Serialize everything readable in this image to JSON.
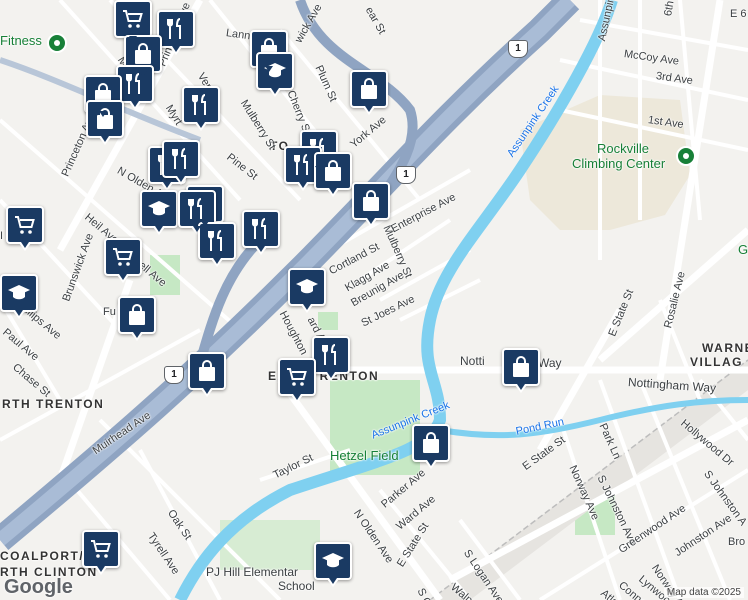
{
  "map": {
    "streets": {
      "mulberry_st_top": "Mulberry St",
      "mulberry_st_mid": "Mulberry St",
      "princeton_ave_top": "Princeton Ave",
      "princeton_ave_left": "Princeton Ave",
      "n_olden_ave_top": "N Olden Ave",
      "n_olden_ave_bottom": "N Olden Ave",
      "heil_ave": "Heil Ave",
      "brunswick_ave": "Brunswick Ave",
      "pine_st": "Pine St",
      "york_ave": "York Ave",
      "cherry_st": "Cherry St",
      "plum_st": "Plum St",
      "vernon": "Vern",
      "myrtle": "Myrt",
      "mulberry_partial": "Mul",
      "lanning": "Lannin",
      "wick_ave": "wick Ave",
      "bear_st": "ear St",
      "enterprise_ave": "Enterprise Ave",
      "cortland_st": "Cortland St",
      "klagg_ave": "Klagg Ave",
      "breunig_ave": "Breunig Ave",
      "st_joes_ave": "St Joes Ave",
      "houghton": "Houghton",
      "ward_av": "ard Av",
      "ell_ave": "ell Ave",
      "fu": "Fu",
      "phillips_ave": "hillips Ave",
      "paul_ave": "Paul Ave",
      "chase_st": "Chase St",
      "muirhead_ave": "Muirhead Ave",
      "oak_st": "Oak St",
      "tyrell_ave": "Tyrell Ave",
      "taylor_st": "Taylor St",
      "parker_ave": "Parker Ave",
      "ward_ave": "Ward Ave",
      "e_state_st_lower": "E State St",
      "e_state_st_right": "E State St",
      "e_state_st_mid": "E State St",
      "s_logan_ave": "S Logan Ave",
      "walnut_ave": "Walnut Ave",
      "s_ol": "S Ol",
      "nottingham_way": "Nottingham Way",
      "nottingham_partial": "Notti",
      "nottingham_way_suffix": "Way",
      "assunpink_blvd": "Assunpink B",
      "mccoy_ave": "McCoy Ave",
      "third_ave": "3rd Ave",
      "first_ave": "1st Ave",
      "sixth": "6th",
      "park_ln": "Park Ln",
      "hollywood_dr": "Hollywood Dr",
      "norway_ave": "Norway Ave",
      "s_johnston_ave": "S Johnston Ave",
      "greenwood_ave": "Greenwood Ave",
      "johnston_ave": "Johnston Ave",
      "norway_ave2": "Norway Ave",
      "lynwood": "Lynwood",
      "connect": "Connect",
      "atlan": "Atlan",
      "rosalie_ave": "Rosalie Ave",
      "bro": "Bro",
      "s_johnston_partial": "S Johnston A",
      "e6": "E 6",
      "i_partial": "I",
      "g_partial": "G"
    },
    "areas": {
      "east_trenton": "EAST TRENTON",
      "north_trenton": "RTH TRENTON",
      "coalport": "COALPORT/",
      "north_clinton": "RTH CLINTON",
      "warne_villag_1": "WARNE",
      "warne_villag_2": "VILLAG",
      "to_partial": "TO"
    },
    "places": {
      "fitness": "Fitness",
      "rockville_1": "Rockville",
      "rockville_2": "Climbing Center",
      "hetzel_field": "Hetzel Field",
      "pj_hill_1": "PJ Hill Elementar",
      "pj_hill_2": "School"
    },
    "water": {
      "assunpink_creek_1": "Assunpink Creek",
      "assunpink_creek_2": "Assunpink Creek",
      "pond_run": "Pond Run"
    },
    "route_shields": {
      "us1_a": "1",
      "us1_b": "1",
      "us1_c": "1"
    },
    "pins": [
      {
        "type": "grocery",
        "icon": "cart-icon"
      },
      {
        "type": "restaurant",
        "icon": "fork-knife-icon"
      },
      {
        "type": "shopping",
        "icon": "shopping-bag-icon"
      },
      {
        "type": "school",
        "icon": "graduation-cap-icon"
      }
    ],
    "attribution": "Map data ©2025",
    "logo": "Google",
    "colors": {
      "pin": "#1a3a63",
      "highway": "#8fa4c2",
      "water": "#7fd0f0",
      "park": "#c6e8c4"
    }
  }
}
